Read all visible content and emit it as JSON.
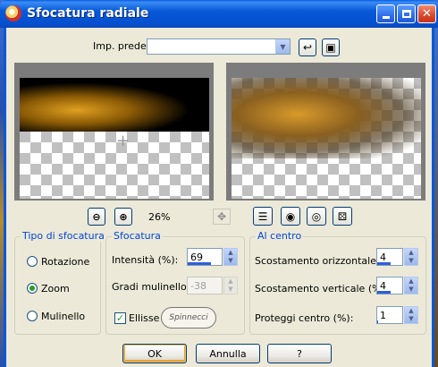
{
  "window": {
    "title": "Sfocatura radiale",
    "controls": [
      "minimize",
      "maximize",
      "close"
    ]
  },
  "preset": {
    "label": "Imp. predef.:",
    "value": "",
    "icons": [
      "reset-arrow-icon",
      "save-floppy-icon"
    ]
  },
  "preview": {
    "zoom_level": "26%",
    "zoom_buttons": [
      "zoom-out-icon",
      "zoom-in-icon"
    ],
    "tool_icons": [
      "pan-icon",
      "settings-list-icon",
      "proof-eye-icon",
      "auto-proof-eye-icon",
      "randomize-dice-icon"
    ]
  },
  "blur_type": {
    "title": "Tipo di sfocatura",
    "options": [
      {
        "label": "Rotazione",
        "checked": false
      },
      {
        "label": "Zoom",
        "checked": true
      },
      {
        "label": "Mulinello",
        "checked": false
      }
    ]
  },
  "blur": {
    "title": "Sfocatura",
    "intensity_label": "Intensità (%):",
    "intensity_value": "69",
    "intensity_fill": 0.69,
    "twirl_label": "Gradi mulinello:",
    "twirl_value": "-38",
    "ellipse_label": "Ellisse",
    "ellipse_checked": true,
    "watermark_text": "Spinnecci"
  },
  "center": {
    "title": "Al centro",
    "h_offset_label": "Scostamento orizzontale (%):",
    "h_offset_value": "4",
    "h_offset_fill": 0.52,
    "v_offset_label": "Scostamento verticale (%):",
    "v_offset_value": "4",
    "v_offset_fill": 0.52,
    "protect_label": "Proteggi centro (%):",
    "protect_value": "1",
    "protect_fill": 0.01
  },
  "buttons": {
    "ok": "OK",
    "cancel": "Annulla",
    "help": "?"
  },
  "colors": {
    "titlebar": "#0758d8",
    "dialog_bg": "#ece9d8",
    "group_title": "#0046d5",
    "spin_bar": "#2f5dd8"
  }
}
